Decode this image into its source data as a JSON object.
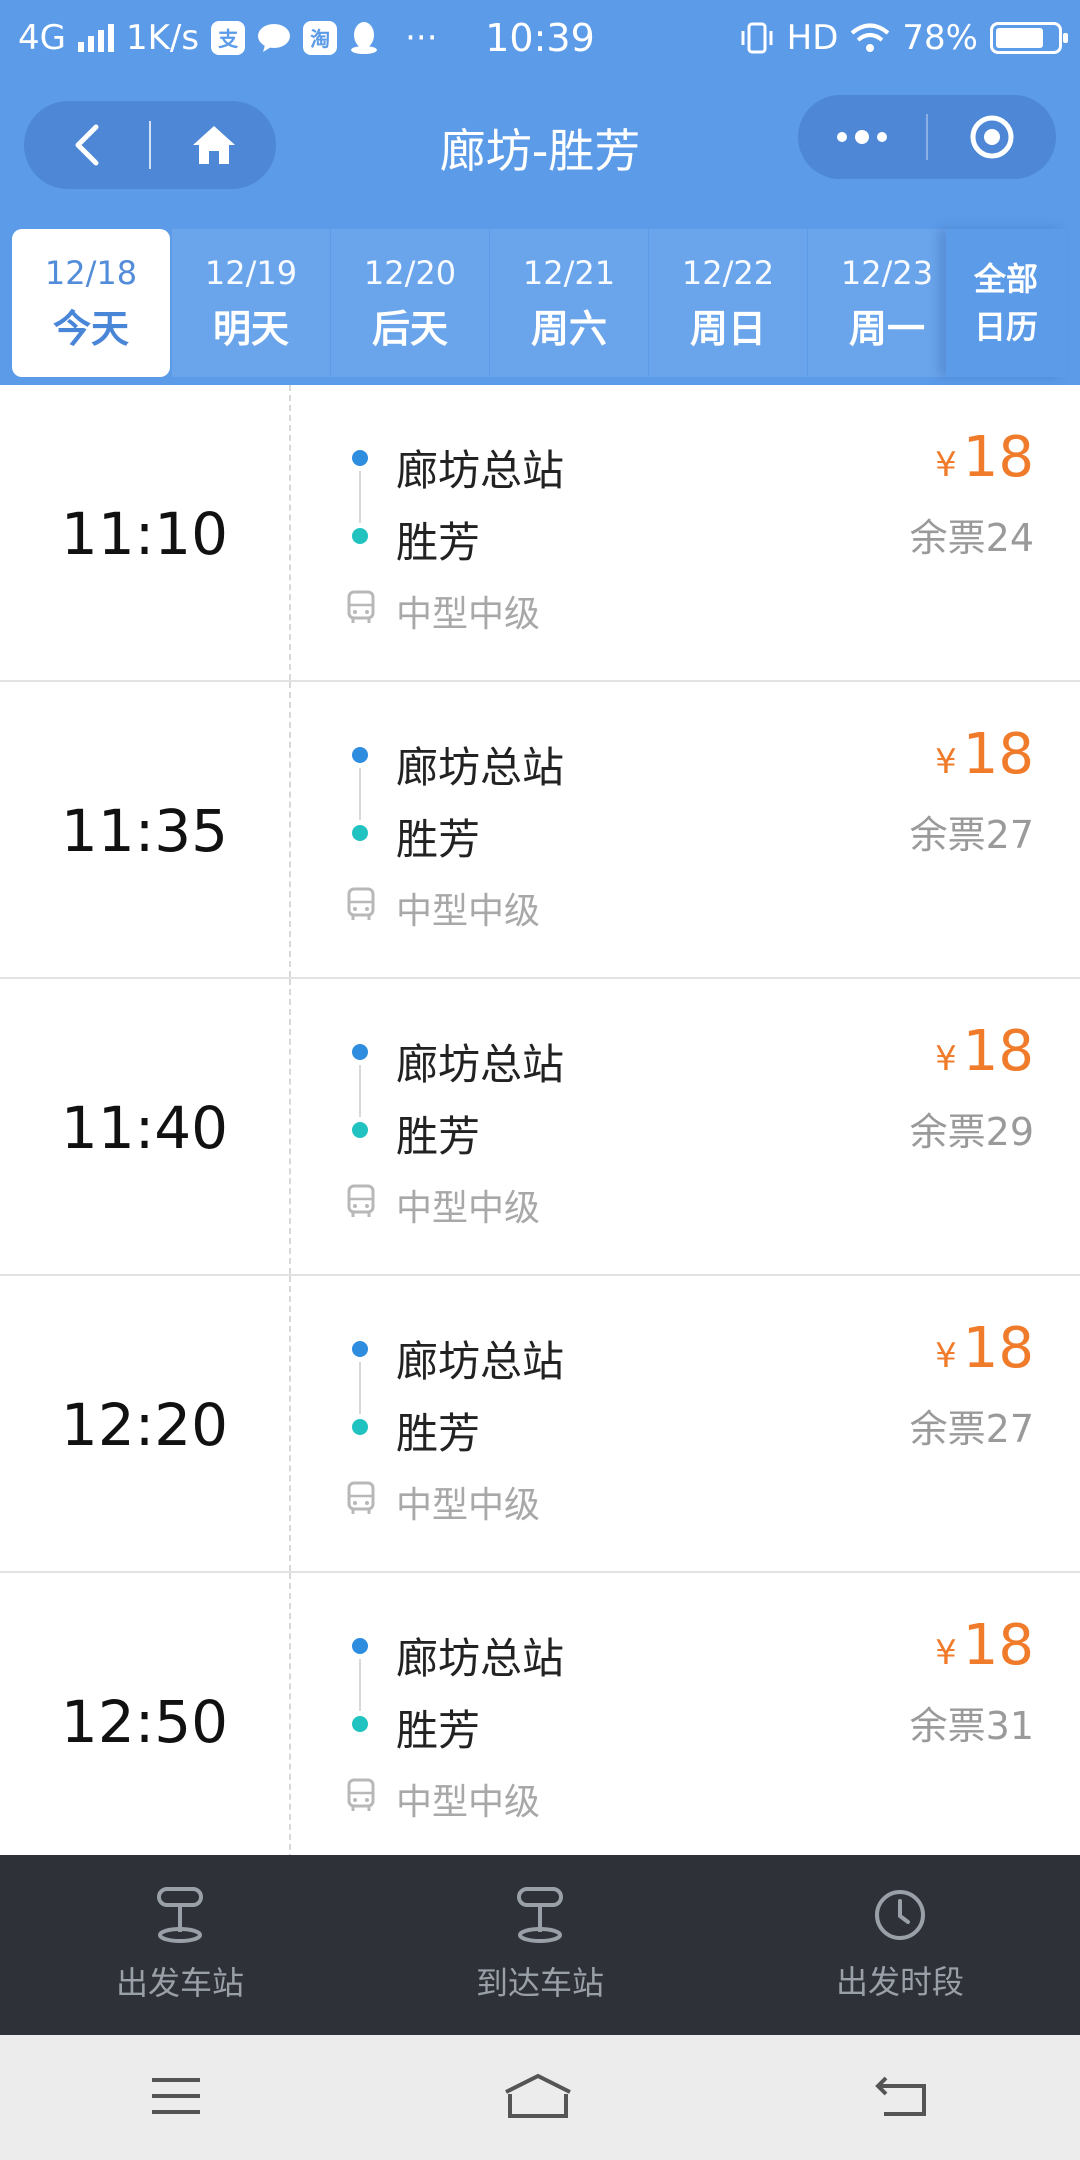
{
  "status_bar": {
    "network": "4G",
    "speed": "1K/s",
    "app_badges": [
      "支",
      "淘"
    ],
    "more": "···",
    "time": "10:39",
    "hd": "HD",
    "battery_text": "78%",
    "battery_level": 0.78
  },
  "header": {
    "title": "廊坊-胜芳"
  },
  "date_tabs": [
    {
      "date": "12/18",
      "weekday": "今天",
      "active": true
    },
    {
      "date": "12/19",
      "weekday": "明天",
      "active": false
    },
    {
      "date": "12/20",
      "weekday": "后天",
      "active": false
    },
    {
      "date": "12/21",
      "weekday": "周六",
      "active": false
    },
    {
      "date": "12/22",
      "weekday": "周日",
      "active": false
    },
    {
      "date": "12/23",
      "weekday": "周一",
      "active": false
    }
  ],
  "all_dates": {
    "line1": "全部",
    "line2": "日历"
  },
  "trips": [
    {
      "time": "11:10",
      "from": "廊坊总站",
      "to": "胜芳",
      "bus_type": "中型中级",
      "currency": "¥",
      "price": "18",
      "tickets": "余票24"
    },
    {
      "time": "11:35",
      "from": "廊坊总站",
      "to": "胜芳",
      "bus_type": "中型中级",
      "currency": "¥",
      "price": "18",
      "tickets": "余票27"
    },
    {
      "time": "11:40",
      "from": "廊坊总站",
      "to": "胜芳",
      "bus_type": "中型中级",
      "currency": "¥",
      "price": "18",
      "tickets": "余票29"
    },
    {
      "time": "12:20",
      "from": "廊坊总站",
      "to": "胜芳",
      "bus_type": "中型中级",
      "currency": "¥",
      "price": "18",
      "tickets": "余票27"
    },
    {
      "time": "12:50",
      "from": "廊坊总站",
      "to": "胜芳",
      "bus_type": "中型中级",
      "currency": "¥",
      "price": "18",
      "tickets": "余票31"
    }
  ],
  "filters": [
    {
      "label": "出发车站",
      "icon": "station-sign-icon"
    },
    {
      "label": "到达车站",
      "icon": "station-sign-icon"
    },
    {
      "label": "出发时段",
      "icon": "clock-icon"
    }
  ],
  "colors": {
    "brand_blue": "#5b9be8",
    "price_orange": "#f07b2a",
    "origin_dot": "#2f8de0",
    "destination_dot": "#21c3c0",
    "filter_bar": "#2f3138"
  }
}
